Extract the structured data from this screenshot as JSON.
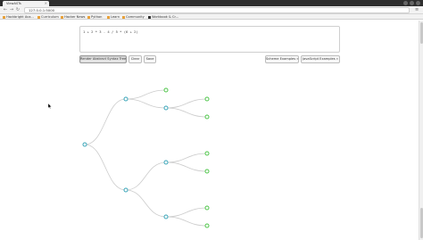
{
  "browser": {
    "tab_title": "ViewASTs",
    "tab_close": "×",
    "back_icon": "back-arrow-icon",
    "forward_icon": "forward-arrow-icon",
    "reload_icon": "reload-icon",
    "back_glyph": "←",
    "forward_glyph": "→",
    "reload_glyph": "↻",
    "url": "127.0.0.1:5000",
    "menu_glyph": "≡"
  },
  "bookmarks": [
    {
      "label": "Hackbright Aca..."
    },
    {
      "label": "Curriculum"
    },
    {
      "label": "Hacker News"
    },
    {
      "label": "Python"
    },
    {
      "label": "Learn"
    },
    {
      "label": "Community"
    },
    {
      "label": "Workbook & Cr..."
    }
  ],
  "editor": {
    "code": "1 + 2 * 3 - 4 / 5 * (6 + 2)"
  },
  "toolbar": {
    "render_label": "Render Abstract Syntax Tree",
    "clear_label": "Clear",
    "save_label": "Save",
    "scheme_label": "Scheme Examples »",
    "js_label": "JavaScript Examples »"
  },
  "colors": {
    "node_stroke": "#3aa6b9",
    "leaf_stroke": "#4fc64a",
    "link": "#cccccc"
  }
}
